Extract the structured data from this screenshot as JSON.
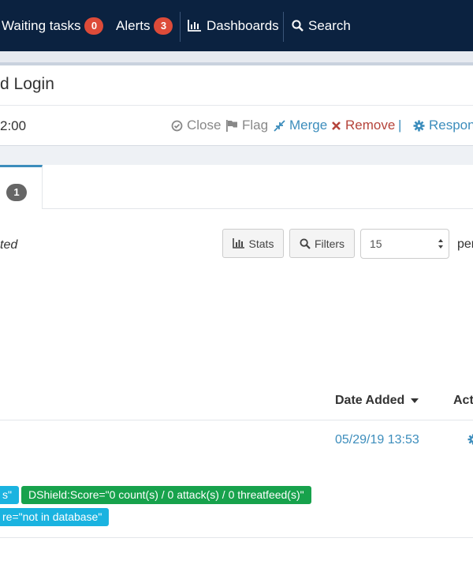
{
  "nav": {
    "waiting_tasks_label": "Waiting tasks",
    "waiting_tasks_count": "0",
    "alerts_label": "Alerts",
    "alerts_count": "3",
    "dashboards_label": "Dashboards",
    "search_label": "Search"
  },
  "case": {
    "title": "d Login",
    "date": "2:00",
    "actions": {
      "close": "Close",
      "flag": "Flag",
      "merge": "Merge",
      "remove": "Remove",
      "separator": "|",
      "respond": "Respon"
    }
  },
  "tabs": {
    "active_badge": "1"
  },
  "toolbar": {
    "selection_text": "ted",
    "stats_label": "Stats",
    "filters_label": "Filters",
    "per_page_value": "15",
    "per_page_label": "per"
  },
  "table": {
    "columns": {
      "date_added": "Date Added",
      "actions": "Act"
    },
    "rows": [
      {
        "date_added": "05/29/19 13:53",
        "tags": [
          "s\"",
          "DShield:Score=\"0 count(s) / 0 attack(s) / 0 threatfeed(s)\"",
          "re=\"not in database\""
        ]
      }
    ]
  },
  "colors": {
    "navbar": "#0b2240",
    "badge": "#dd4b39",
    "link": "#3c8dbc",
    "remove": "#b5443b",
    "tag_blue": "#1ab3e0",
    "tag_green": "#17a24c"
  },
  "icons": [
    "dashboard-chart-icon",
    "search-icon",
    "check-circle-icon",
    "flag-icon",
    "merge-arrows-icon",
    "remove-x-icon",
    "gear-icon",
    "bar-chart-icon",
    "caret-down-icon",
    "select-arrows-icon"
  ]
}
